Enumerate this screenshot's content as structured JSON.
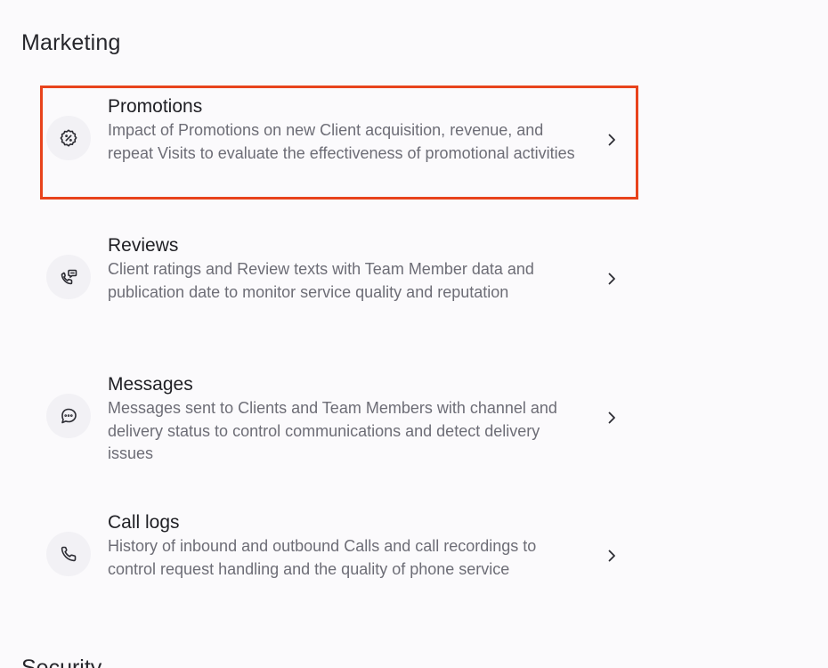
{
  "section": {
    "title": "Marketing"
  },
  "items": [
    {
      "title": "Promotions",
      "description": "Impact of Promotions on new Client acquisition, revenue, and repeat Visits to evaluate the effectiveness of promotional activities",
      "icon": "promotion-badge-icon",
      "highlighted": true
    },
    {
      "title": "Reviews",
      "description": "Client ratings and Review texts with Team Member data and publication date to monitor service quality and reputation",
      "icon": "phone-chat-icon",
      "highlighted": false
    },
    {
      "title": "Messages",
      "description": "Messages sent to Clients and Team Members with channel and delivery status to control communications and detect delivery issues",
      "icon": "message-bubble-icon",
      "highlighted": false
    },
    {
      "title": "Call logs",
      "description": "History of inbound and outbound Calls and call recordings to control request handling and the quality of phone service",
      "icon": "phone-icon",
      "highlighted": false
    }
  ],
  "next_section": {
    "title": "Security"
  },
  "colors": {
    "highlight_border": "#e8431c",
    "icon_bg": "#f2f1f5",
    "description_text": "#6d6d76"
  }
}
